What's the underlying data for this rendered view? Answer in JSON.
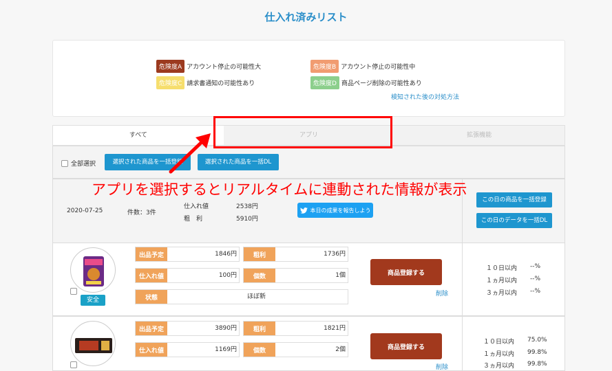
{
  "page_title": "仕入れ済みリスト",
  "legend": {
    "a": {
      "badge": "危険度A",
      "text": "アカウント停止の可能性大",
      "color": "#9c3a1f"
    },
    "b": {
      "badge": "危険度B",
      "text": "アカウント停止の可能性中",
      "color": "#f19c71"
    },
    "c": {
      "badge": "危険度C",
      "text": "請求書通知の可能性あり",
      "color": "#f6de6d"
    },
    "d": {
      "badge": "危険度D",
      "text": "商品ページ削除の可能性あり",
      "color": "#8ccf8c"
    },
    "help_link": "検知された後の対処方法"
  },
  "tabs": [
    "すべて",
    "アプリ",
    "拡張機能"
  ],
  "toolbar": {
    "select_all": "全部選択",
    "bulk_register": "選択された商品を一括登録",
    "bulk_dl": "選択された商品を一括DL"
  },
  "annotation": "アプリを選択するとリアルタイムに連動された情報が表示",
  "day": {
    "date": "2020-07-25",
    "count": "件数：3件",
    "purchase_label": "仕入れ値",
    "purchase_value": "2538円",
    "profit_label": "粗　利",
    "profit_value": "5910円",
    "tweet": "本日の成果を報告しよう",
    "register_day": "この日の商品を一括登録",
    "dl_day": "この日のデータを一括DL"
  },
  "items": [
    {
      "labels": {
        "listing": "出品予定",
        "profit": "粗利",
        "cost": "仕入れ値",
        "qty": "個数",
        "cond": "状態"
      },
      "listing": "1846円",
      "profit": "1736円",
      "cost": "100円",
      "qty": "1個",
      "cond": "ほぼ新",
      "register": "商品登録する",
      "delete": "削除",
      "safety": "安全",
      "stats": [
        {
          "label": "１０日以内",
          "value": "--%"
        },
        {
          "label": "１ヵ月以内",
          "value": "--%"
        },
        {
          "label": "３ヵ月以内",
          "value": "--%"
        }
      ]
    },
    {
      "labels": {
        "listing": "出品予定",
        "profit": "粗利",
        "cost": "仕入れ値",
        "qty": "個数"
      },
      "listing": "3890円",
      "profit": "1821円",
      "cost": "1169円",
      "qty": "2個",
      "register": "商品登録する",
      "delete": "削除",
      "stats": [
        {
          "label": "１０日以内",
          "value": "75.0%"
        },
        {
          "label": "１ヵ月以内",
          "value": "99.8%"
        },
        {
          "label": "３ヵ月以内",
          "value": "99.8%"
        }
      ]
    }
  ]
}
